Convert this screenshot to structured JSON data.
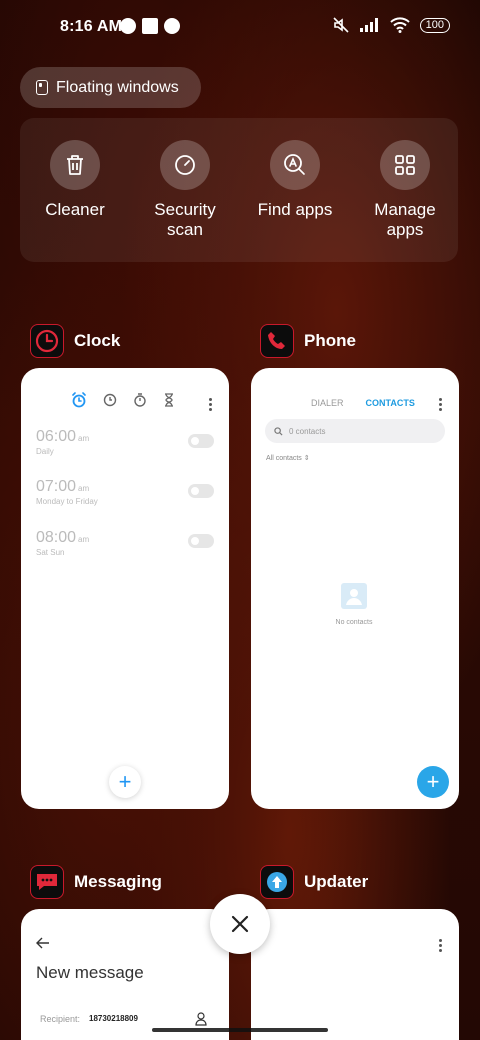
{
  "status_bar": {
    "time": "8:16 AM",
    "battery": "100"
  },
  "floating_windows": {
    "label": "Floating windows"
  },
  "quick_actions": [
    {
      "label": "Cleaner",
      "icon": "trash-icon"
    },
    {
      "label": "Security scan",
      "icon": "security-scan-icon"
    },
    {
      "label": "Find apps",
      "icon": "find-apps-icon"
    },
    {
      "label": "Manage apps",
      "icon": "grid-icon"
    }
  ],
  "recents": {
    "clock": {
      "name": "Clock",
      "alarms": [
        {
          "time": "06:00",
          "ampm": "am",
          "days": "Daily"
        },
        {
          "time": "07:00",
          "ampm": "am",
          "days": "Monday to Friday"
        },
        {
          "time": "08:00",
          "ampm": "am",
          "days": "Sat Sun"
        }
      ]
    },
    "phone": {
      "name": "Phone",
      "tab_dialer": "DIALER",
      "tab_contacts": "CONTACTS",
      "search_placeholder": "0 contacts",
      "filter_label": "All contacts",
      "empty_text": "No contacts"
    },
    "messaging": {
      "name": "Messaging",
      "title": "New message",
      "recipient_label": "Recipient:",
      "recipient_value": "18730218809"
    },
    "updater": {
      "name": "Updater"
    }
  },
  "colors": {
    "accent_blue": "#2196f3",
    "contacts_blue": "#1e9be0",
    "icon_red": "#c8192b"
  }
}
